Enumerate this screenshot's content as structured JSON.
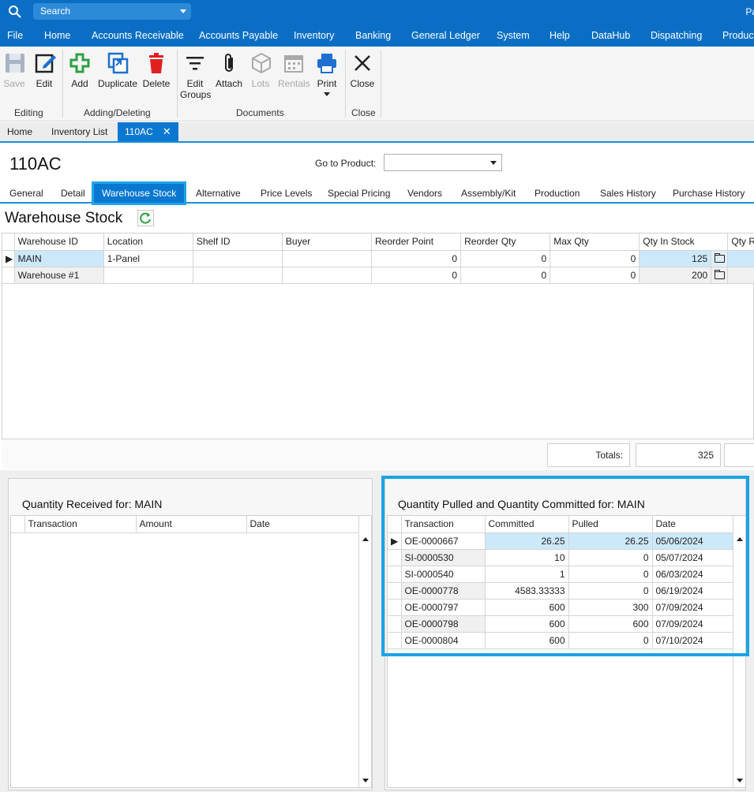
{
  "topbar": {
    "search_placeholder": "Search",
    "user_stub": "Pa"
  },
  "menu": [
    "File",
    "Home",
    "Accounts Receivable",
    "Accounts Payable",
    "Inventory",
    "Banking",
    "General Ledger",
    "System",
    "Help",
    "DataHub",
    "Dispatching",
    "Product"
  ],
  "ribbon": {
    "save": "Save",
    "edit": "Edit",
    "add": "Add",
    "duplicate": "Duplicate",
    "delete": "Delete",
    "edit_groups_1": "Edit",
    "edit_groups_2": "Groups",
    "attach": "Attach",
    "lots": "Lots",
    "rentals": "Rentals",
    "print": "Print",
    "close": "Close",
    "group_editing": "Editing",
    "group_adding": "Adding/Deleting",
    "group_documents": "Documents",
    "group_close": "Close"
  },
  "doc_tabs": [
    "Home",
    "Inventory List",
    "110AC"
  ],
  "page": {
    "title": "110AC",
    "goto_label": "Go to Product:",
    "goto_value": ""
  },
  "sub_tabs": [
    "General",
    "Detail",
    "Warehouse Stock",
    "Alternative",
    "Price Levels",
    "Special Pricing",
    "Vendors",
    "Assembly/Kit",
    "Production",
    "Sales History",
    "Purchase History"
  ],
  "section_title": "Warehouse Stock",
  "stock_grid": {
    "columns": [
      "Warehouse ID",
      "Location",
      "Shelf ID",
      "Buyer",
      "Reorder Point",
      "Reorder Qty",
      "Max Qty",
      "Qty In Stock",
      "Qty Re"
    ],
    "rows": [
      {
        "warehouse": "MAIN",
        "location": "1-Panel",
        "shelf": "",
        "buyer": "",
        "reorder_point": "0",
        "reorder_qty": "0",
        "max_qty": "0",
        "qty_in_stock": "125"
      },
      {
        "warehouse": "Warehouse #1",
        "location": "",
        "shelf": "",
        "buyer": "",
        "reorder_point": "0",
        "reorder_qty": "0",
        "max_qty": "0",
        "qty_in_stock": "200"
      }
    ],
    "totals_label": "Totals:",
    "totals_value": "325"
  },
  "received_panel": {
    "title": "Quantity Received for: MAIN",
    "columns": [
      "Transaction",
      "Amount",
      "Date"
    ]
  },
  "pulled_panel": {
    "title": "Quantity Pulled and Quantity Committed for: MAIN",
    "columns": [
      "Transaction",
      "Committed",
      "Pulled",
      "Date"
    ],
    "rows": [
      {
        "txn": "OE-0000667",
        "committed": "26.25",
        "pulled": "26.25",
        "date": "05/06/2024"
      },
      {
        "txn": "SI-0000530",
        "committed": "10",
        "pulled": "0",
        "date": "05/07/2024"
      },
      {
        "txn": "SI-0000540",
        "committed": "1",
        "pulled": "0",
        "date": "06/03/2024"
      },
      {
        "txn": "OE-0000778",
        "committed": "4583.33333",
        "pulled": "0",
        "date": "06/19/2024"
      },
      {
        "txn": "OE-0000797",
        "committed": "600",
        "pulled": "300",
        "date": "07/09/2024"
      },
      {
        "txn": "OE-0000798",
        "committed": "600",
        "pulled": "600",
        "date": "07/09/2024"
      },
      {
        "txn": "OE-0000804",
        "committed": "600",
        "pulled": "0",
        "date": "07/10/2024"
      }
    ]
  },
  "colors": {
    "brand_blue": "#0a6fc4",
    "highlight_cyan": "#1da3e4",
    "selection": "#cce8fb"
  }
}
